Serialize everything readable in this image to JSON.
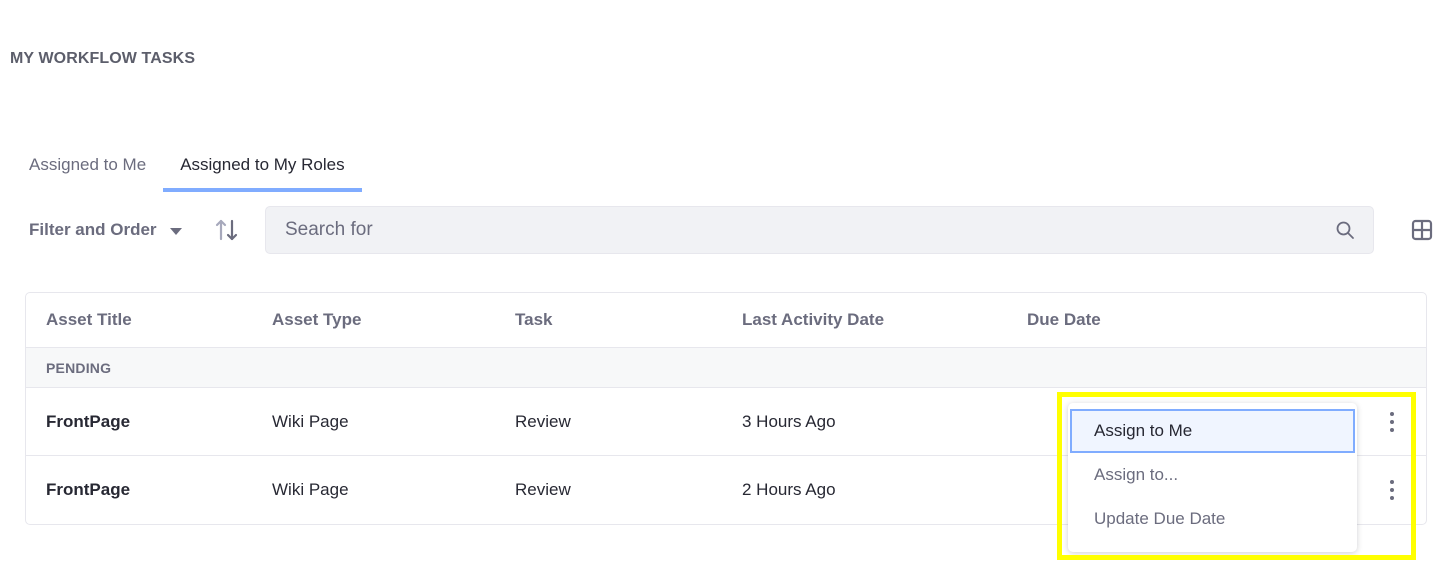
{
  "page": {
    "title": "MY WORKFLOW TASKS"
  },
  "tabs": [
    {
      "label": "Assigned to Me",
      "active": false
    },
    {
      "label": "Assigned to My Roles",
      "active": true
    }
  ],
  "toolbar": {
    "filter_label": "Filter and Order",
    "filter_icon": "caret-down-icon",
    "sort_icon": "order-arrows-icon",
    "search_placeholder": "Search for",
    "search_value": "",
    "search_icon": "search-icon",
    "view_icon": "cards-view-icon"
  },
  "table": {
    "headers": [
      "Asset Title",
      "Asset Type",
      "Task",
      "Last Activity Date",
      "Due Date"
    ],
    "group_label": "PENDING",
    "rows": [
      {
        "asset_title": "FrontPage",
        "asset_type": "Wiki Page",
        "task": "Review",
        "last_activity": "3 Hours Ago",
        "due_date": ""
      },
      {
        "asset_title": "FrontPage",
        "asset_type": "Wiki Page",
        "task": "Review",
        "last_activity": "2 Hours Ago",
        "due_date": ""
      }
    ],
    "row_action_icon": "vertical-ellipsis-icon"
  },
  "dropdown": {
    "items": [
      {
        "label": "Assign to Me",
        "active": true
      },
      {
        "label": "Assign to...",
        "active": false
      },
      {
        "label": "Update Due Date",
        "active": false
      }
    ]
  },
  "colors": {
    "accent": "#80acff",
    "highlight": "#ffff00",
    "text_primary": "#272833",
    "text_secondary": "#6b6c7e"
  }
}
